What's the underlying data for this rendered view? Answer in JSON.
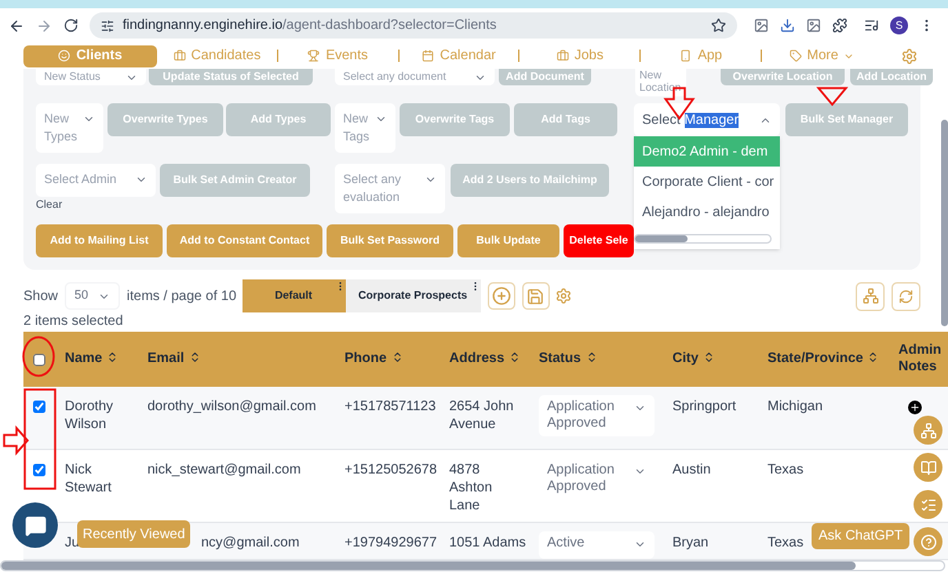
{
  "browser": {
    "url_host": "findingnanny.enginehire.io",
    "url_path": "/agent-dashboard?selector=Clients",
    "profile_initial": "S"
  },
  "nav": {
    "tabs": [
      {
        "label": "Clients",
        "selected": true
      },
      {
        "label": "Candidates",
        "selected": false
      },
      {
        "label": "Events",
        "selected": false
      },
      {
        "label": "Calendar",
        "selected": false
      },
      {
        "label": "Jobs",
        "selected": false
      },
      {
        "label": "App",
        "selected": false
      },
      {
        "label": "More",
        "selected": false
      }
    ]
  },
  "bulk_actions": {
    "groups": [
      {
        "items": [
          {
            "kind": "select",
            "placeholder": "New Status"
          },
          {
            "kind": "muted",
            "label": "Update Status of Selected"
          },
          {
            "kind": "select",
            "placeholder": "Select any document"
          },
          {
            "kind": "muted",
            "label": "Add Document"
          },
          {
            "kind": "input",
            "placeholder": "New Location"
          },
          {
            "kind": "muted",
            "label": "Overwrite Location"
          },
          {
            "kind": "muted",
            "label": "Add Location"
          }
        ]
      },
      {
        "items": [
          {
            "kind": "select",
            "placeholder": "New Types"
          },
          {
            "kind": "muted",
            "label": "Overwrite Types"
          },
          {
            "kind": "muted",
            "label": "Add Types"
          },
          {
            "kind": "select",
            "placeholder": "New Tags"
          },
          {
            "kind": "muted",
            "label": "Overwrite Tags"
          },
          {
            "kind": "muted",
            "label": "Add Tags"
          },
          {
            "kind": "dropdown",
            "label": "Select",
            "highlighted": "Manager",
            "options": [
              {
                "label": "Demo2 Admin - dem",
                "selected": true
              },
              {
                "label": "Corporate Client - cor",
                "selected": false
              },
              {
                "label": "Alejandro - alejandro",
                "selected": false
              }
            ]
          },
          {
            "kind": "muted",
            "label": "Bulk Set Manager"
          }
        ]
      },
      {
        "items": [
          {
            "kind": "select",
            "placeholder": "Select Admin"
          },
          {
            "kind": "muted",
            "label": "Bulk Set Admin Creator"
          },
          {
            "kind": "select",
            "placeholder": "Select any evaluation"
          },
          {
            "kind": "muted",
            "label": "Add 2 Users to Mailchimp"
          }
        ]
      },
      {
        "items": [
          {
            "kind": "primary",
            "label": "Add to Mailing List"
          },
          {
            "kind": "primary",
            "label": "Add to Constant Contact"
          },
          {
            "kind": "primary",
            "label": "Bulk Set Password"
          },
          {
            "kind": "primary",
            "label": "Bulk Update"
          },
          {
            "kind": "danger",
            "label": "Delete Sele"
          }
        ]
      }
    ],
    "clear_link": "Clear"
  },
  "toolbar": {
    "show_label": "Show",
    "page_size": "50",
    "page_info": "items / page of 10",
    "views": [
      {
        "label": "Default",
        "selected": true
      },
      {
        "label": "Corporate Prospects",
        "selected": false
      }
    ]
  },
  "selection_count": "2 items selected",
  "table": {
    "all_checked": false,
    "columns": [
      {
        "label": "Name",
        "sortable": true
      },
      {
        "label": "Email",
        "sortable": true
      },
      {
        "label": "Phone",
        "sortable": true
      },
      {
        "label": "Address",
        "sortable": true
      },
      {
        "label": "Status",
        "sortable": true
      },
      {
        "label": "City",
        "sortable": true
      },
      {
        "label": "State/Province",
        "sortable": true
      },
      {
        "label": "Admin Notes",
        "sortable": false
      }
    ],
    "rows": [
      {
        "checked": true,
        "name": "Dorothy Wilson",
        "email": "dorothy_wilson@gmail.com",
        "phone": "+15178571123",
        "address": "2654 John Avenue",
        "status": "Application Approved",
        "city": "Springport",
        "state": "Michigan",
        "has_note_button": true
      },
      {
        "checked": true,
        "name": "Nick Stewart",
        "email": "nick_stewart@gmail.com",
        "phone": "+15125052678",
        "address": "4878 Ashton Lane",
        "status": "Application Approved",
        "city": "Austin",
        "state": "Texas",
        "has_note_button": false
      },
      {
        "name": "Ju",
        "email": "ncy@gmail.com",
        "phone": "+19794929677",
        "address": "1051 Adams",
        "status": "Active",
        "city": "Bryan",
        "state": "Texas",
        "has_note_button": false
      }
    ]
  },
  "floating": {
    "recently_viewed": "Recently Viewed",
    "ask_chatgpt": "Ask ChatGPT"
  }
}
